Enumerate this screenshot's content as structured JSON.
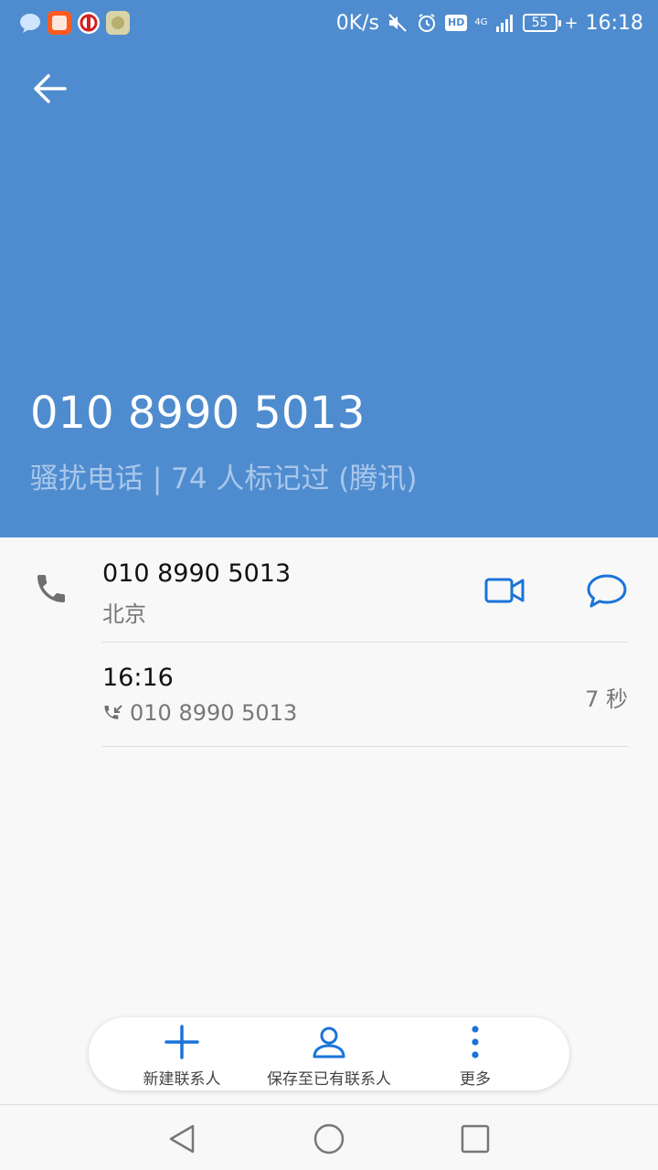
{
  "status_bar": {
    "net_speed": "0K/s",
    "network": "4G",
    "battery": "55",
    "time": "16:18"
  },
  "header": {
    "number": "010 8990 5013",
    "tag": "骚扰电话 | 74 人标记过 (腾讯)"
  },
  "contact": {
    "number": "010 8990 5013",
    "location": "北京"
  },
  "call_log": {
    "time": "16:16",
    "number": "010 8990 5013",
    "duration": "7 秒"
  },
  "actions": {
    "new_contact": "新建联系人",
    "save_existing": "保存至已有联系人",
    "more": "更多"
  },
  "colors": {
    "header_bg": "#4f8ccf",
    "accent": "#1a73d9"
  }
}
